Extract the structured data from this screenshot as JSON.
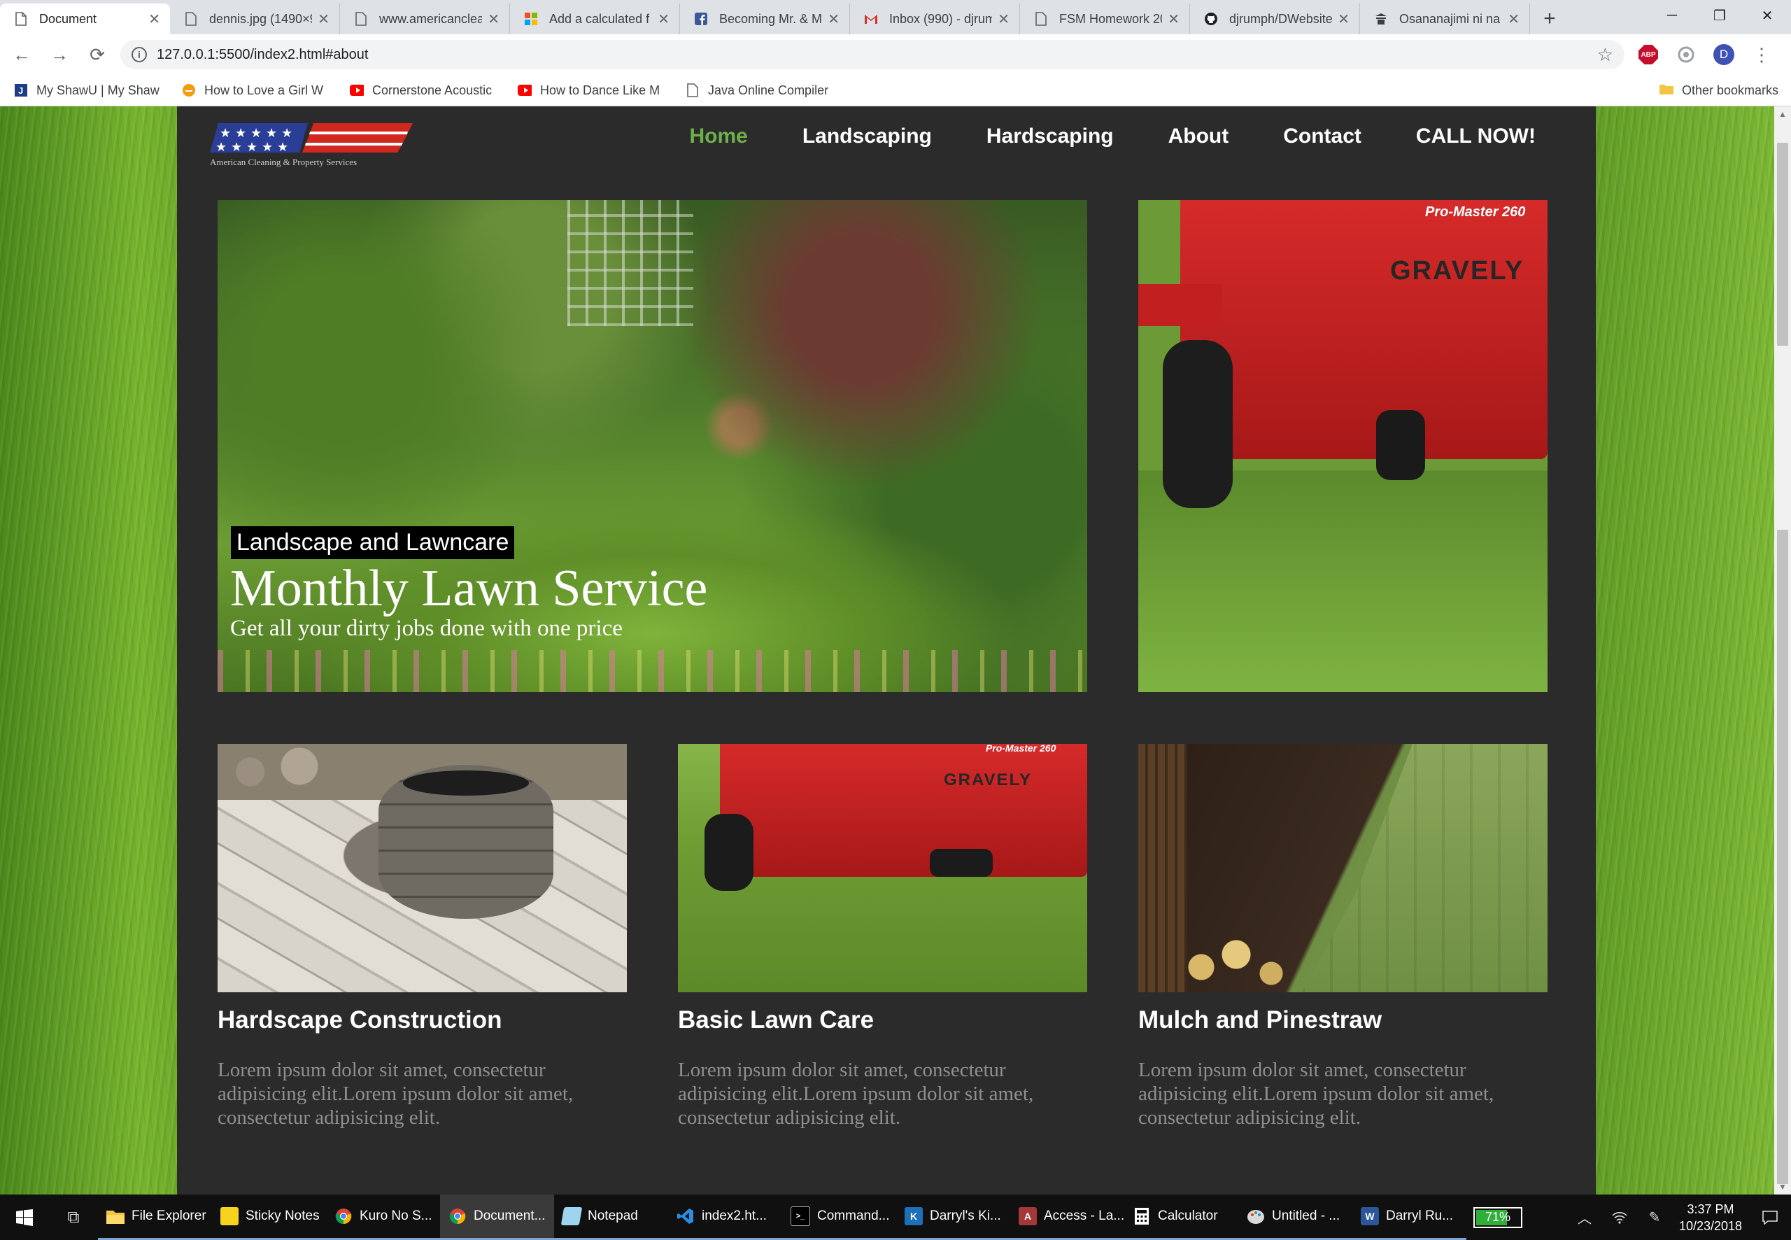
{
  "browser": {
    "tabs": [
      {
        "title": "Document",
        "icon": "page-icon",
        "active": true
      },
      {
        "title": "dennis.jpg (1490×9",
        "icon": "page-icon"
      },
      {
        "title": "www.americanclea",
        "icon": "page-icon"
      },
      {
        "title": "Add a calculated f",
        "icon": "microsoft-icon"
      },
      {
        "title": "Becoming Mr. & M",
        "icon": "facebook-icon"
      },
      {
        "title": "Inbox (990) - djrum",
        "icon": "gmail-icon"
      },
      {
        "title": "FSM Homework 20",
        "icon": "page-icon"
      },
      {
        "title": "djrumph/DWebsite",
        "icon": "github-icon"
      },
      {
        "title": "Osananajimi ni na",
        "icon": "site-icon"
      }
    ],
    "url": "127.0.0.1:5500/index2.html#about",
    "profile_initial": "D",
    "abp_label": "ABP",
    "bookmarks": [
      {
        "label": "My ShawU | My Shaw",
        "icon": "j-icon"
      },
      {
        "label": "How to Love a Girl W",
        "icon": "orange-circle-icon"
      },
      {
        "label": "Cornerstone Acoustic",
        "icon": "youtube-icon"
      },
      {
        "label": "How to Dance Like M",
        "icon": "youtube-icon"
      },
      {
        "label": "Java Online Compiler",
        "icon": "page-icon"
      }
    ],
    "other_bookmarks": "Other bookmarks"
  },
  "site": {
    "logo_tagline": "American Cleaning & Property Services",
    "nav": [
      {
        "label": "Home",
        "current": true
      },
      {
        "label": "Landscaping"
      },
      {
        "label": "Hardscaping"
      },
      {
        "label": "About"
      },
      {
        "label": "Contact"
      },
      {
        "label": "CALL NOW!"
      }
    ],
    "hero": {
      "badge": "Landscape and Lawncare",
      "headline": "Monthly Lawn Service",
      "subhead": "Get all your dirty jobs done with one price"
    },
    "mower_brand": "GRAVELY",
    "mower_model": "Pro-Master 260",
    "cards": [
      {
        "title": "Hardscape Construction",
        "text": "Lorem ipsum dolor sit amet, consectetur adipisicing elit.Lorem ipsum dolor sit amet, consectetur adipisicing elit."
      },
      {
        "title": "Basic Lawn Care",
        "text": "Lorem ipsum dolor sit amet, consectetur adipisicing elit.Lorem ipsum dolor sit amet, consectetur adipisicing elit."
      },
      {
        "title": "Mulch and Pinestraw",
        "text": "Lorem ipsum dolor sit amet, consectetur adipisicing elit.Lorem ipsum dolor sit amet, consectetur adipisicing elit."
      }
    ],
    "colors": {
      "nav_current": "#6fb04a",
      "panel_bg": "#2b2b2b",
      "flag_red": "#d0281f",
      "flag_blue": "#2a3e97"
    }
  },
  "taskbar": {
    "apps": [
      {
        "label": "File Explorer",
        "icon": "folder-icon"
      },
      {
        "label": "Sticky Notes",
        "icon": "sticky-notes-icon"
      },
      {
        "label": "Kuro No S...",
        "icon": "chrome-icon"
      },
      {
        "label": "Document...",
        "icon": "chrome-icon",
        "active": true
      },
      {
        "label": "Notepad",
        "icon": "notepad-icon"
      },
      {
        "label": "index2.ht...",
        "icon": "vscode-icon"
      },
      {
        "label": "Command...",
        "icon": "cmd-icon"
      },
      {
        "label": "Darryl's Ki...",
        "icon": "kindle-icon"
      },
      {
        "label": "Access - La...",
        "icon": "access-icon"
      },
      {
        "label": "Calculator",
        "icon": "calculator-icon"
      },
      {
        "label": "Untitled - ...",
        "icon": "paint-icon"
      },
      {
        "label": "Darryl Ru...",
        "icon": "word-icon"
      }
    ],
    "battery_label": "71%",
    "battery_level": 0.71,
    "time": "3:37 PM",
    "date": "10/23/2018"
  }
}
